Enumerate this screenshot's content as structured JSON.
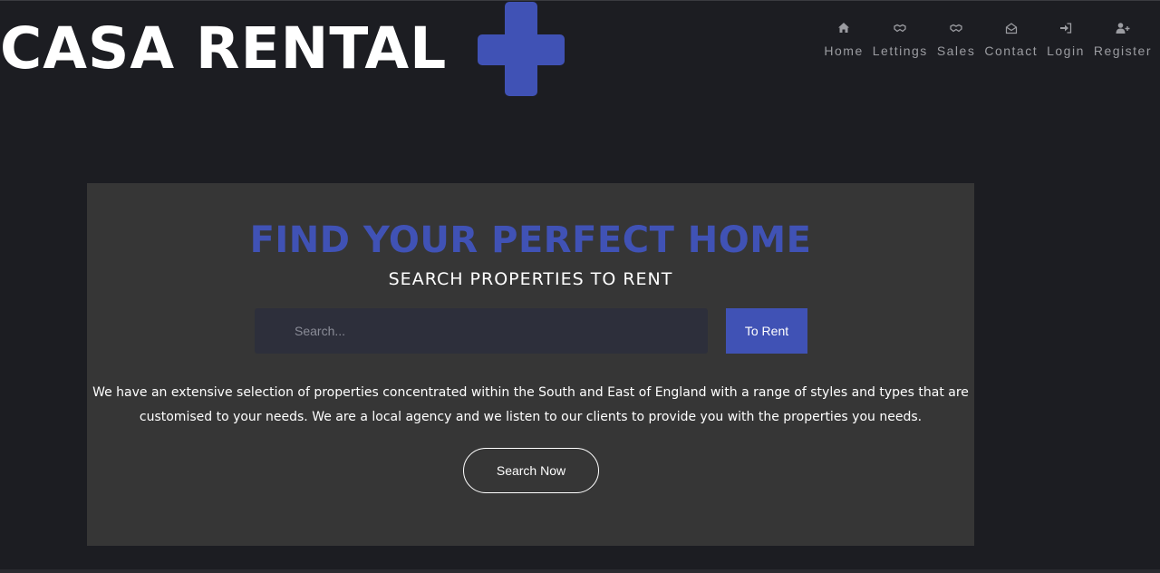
{
  "brand": {
    "logo_text": "CASA RENTAL",
    "accent_color": "#4052b5",
    "cross_icon": "plus-icon"
  },
  "nav": [
    {
      "label": "Home",
      "icon": "home-icon"
    },
    {
      "label": "Lettings",
      "icon": "handshake-icon"
    },
    {
      "label": "Sales",
      "icon": "handshake-icon"
    },
    {
      "label": "Contact",
      "icon": "envelope-open-icon"
    },
    {
      "label": "Login",
      "icon": "sign-in-icon"
    },
    {
      "label": "Register",
      "icon": "user-plus-icon"
    }
  ],
  "hero": {
    "headline": "FIND YOUR PERFECT HOME",
    "subheadline": "SEARCH PROPERTIES TO RENT",
    "search_placeholder": "Search...",
    "search_value": "",
    "rent_button_label": "To Rent",
    "description_line1": "We have an extensive selection of properties concentrated within the South and East of England with a range of styles and types that are",
    "description_line2": "customised to your needs. We are a local agency and we listen to our clients to provide you with the properties you needs.",
    "search_now_label": "Search Now"
  },
  "colors": {
    "background": "#1c1d22",
    "panel": "#363636",
    "nav_text": "#9b9ca1"
  }
}
